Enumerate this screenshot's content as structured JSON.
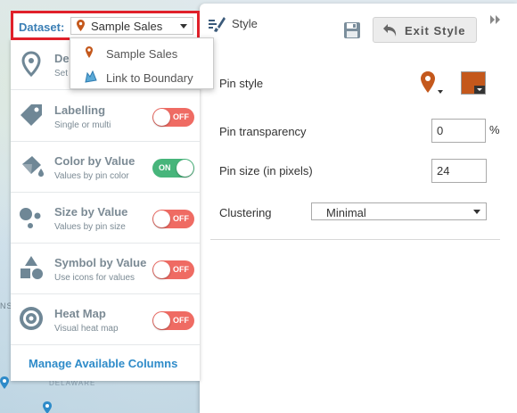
{
  "map": {
    "state_label": "DELAWARE",
    "edge_label": "NS"
  },
  "dataset": {
    "label": "Dataset:",
    "selected": "Sample Sales",
    "options": [
      "Sample Sales",
      "Link to Boundary"
    ]
  },
  "left_panel": {
    "rows": [
      {
        "title": "De",
        "sub": "Set",
        "icon": "map-pin-icon"
      },
      {
        "title": "Labelling",
        "sub": "Single or multi",
        "toggle": "OFF",
        "icon": "tag-icon"
      },
      {
        "title": "Color by Value",
        "sub": "Values by pin color",
        "toggle": "ON",
        "icon": "paint-bucket-icon"
      },
      {
        "title": "Size by Value",
        "sub": "Values by pin size",
        "toggle": "OFF",
        "icon": "circles-size-icon"
      },
      {
        "title": "Symbol by Value",
        "sub": "Use icons for values",
        "toggle": "OFF",
        "icon": "shapes-icon"
      },
      {
        "title": "Heat Map",
        "sub": "Visual heat map",
        "toggle": "OFF",
        "icon": "heat-map-icon"
      }
    ],
    "manage_link": "Manage Available Columns"
  },
  "style_panel": {
    "tab_label": "Style",
    "exit_button": "Exit Style",
    "fields": {
      "pin_style_label": "Pin style",
      "pin_color": "#c4581c",
      "transparency_label": "Pin transparency",
      "transparency_value": "0",
      "transparency_unit": "%",
      "size_label": "Pin size (in pixels)",
      "size_value": "24",
      "clustering_label": "Clustering",
      "clustering_value": "Minimal"
    }
  },
  "colors": {
    "highlight_border": "#e0202a",
    "toggle_off": "#ef6b63",
    "toggle_on": "#47b57b",
    "link": "#2e8bc9",
    "pin": "#c4581c"
  }
}
